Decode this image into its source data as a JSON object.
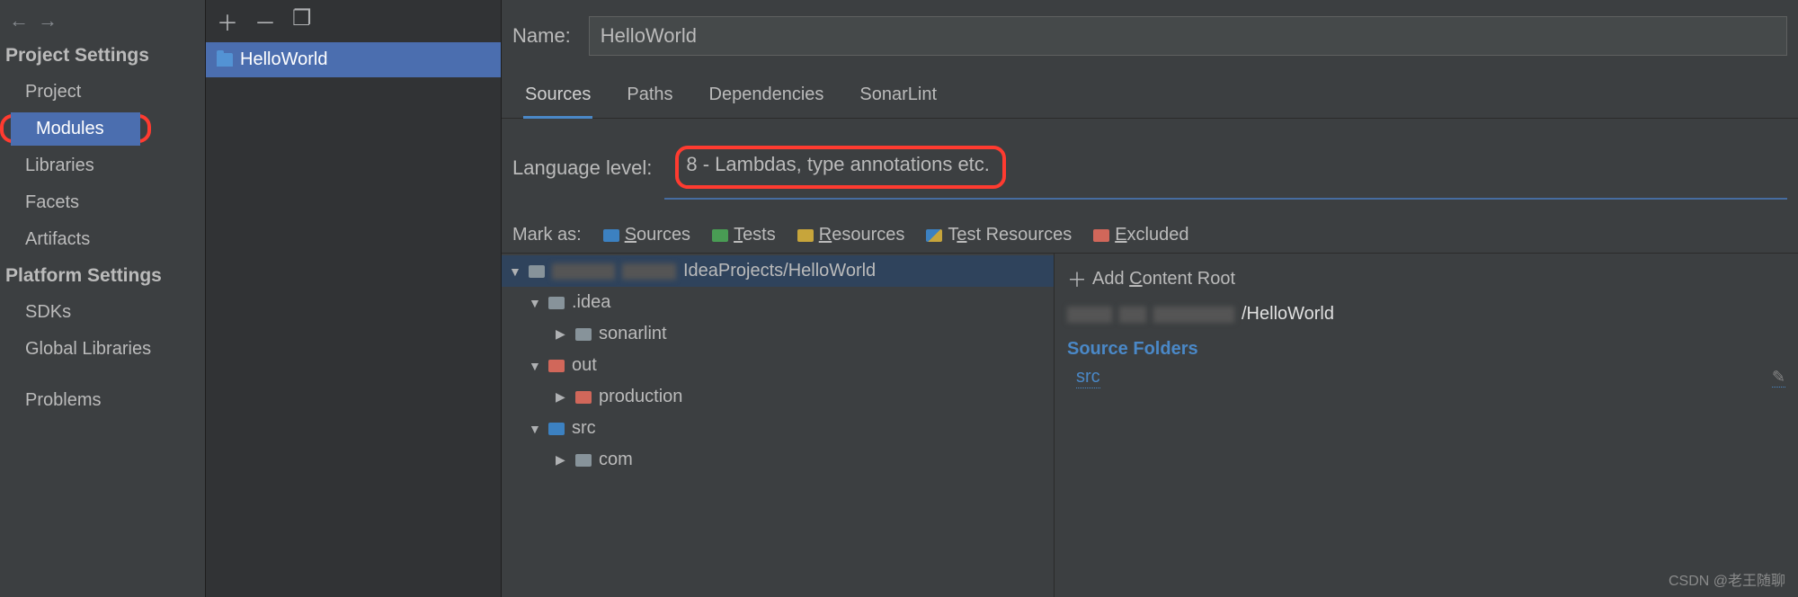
{
  "nav": {
    "section1": "Project Settings",
    "items1": [
      "Project",
      "Modules",
      "Libraries",
      "Facets",
      "Artifacts"
    ],
    "section2": "Platform Settings",
    "items2": [
      "SDKs",
      "Global Libraries"
    ],
    "problems": "Problems"
  },
  "modules": {
    "selected": "HelloWorld"
  },
  "form": {
    "name_label": "Name:",
    "name_value": "HelloWorld",
    "tabs": [
      "Sources",
      "Paths",
      "Dependencies",
      "SonarLint"
    ],
    "lang_label": "Language level:",
    "lang_value": "8 - Lambdas, type annotations etc.",
    "mark_label": "Mark as:",
    "marks": [
      "Sources",
      "Tests",
      "Resources",
      "Test Resources",
      "Excluded"
    ]
  },
  "tree": {
    "root": "IdeaProjects/HelloWorld",
    "idea": ".idea",
    "sonarlint": "sonarlint",
    "out": "out",
    "production": "production",
    "src": "src",
    "com": "com"
  },
  "side": {
    "add_root": "Add Content Root",
    "root_suffix": "/HelloWorld",
    "source_folders": "Source Folders",
    "src": "src"
  },
  "watermark": "CSDN @老王随聊"
}
